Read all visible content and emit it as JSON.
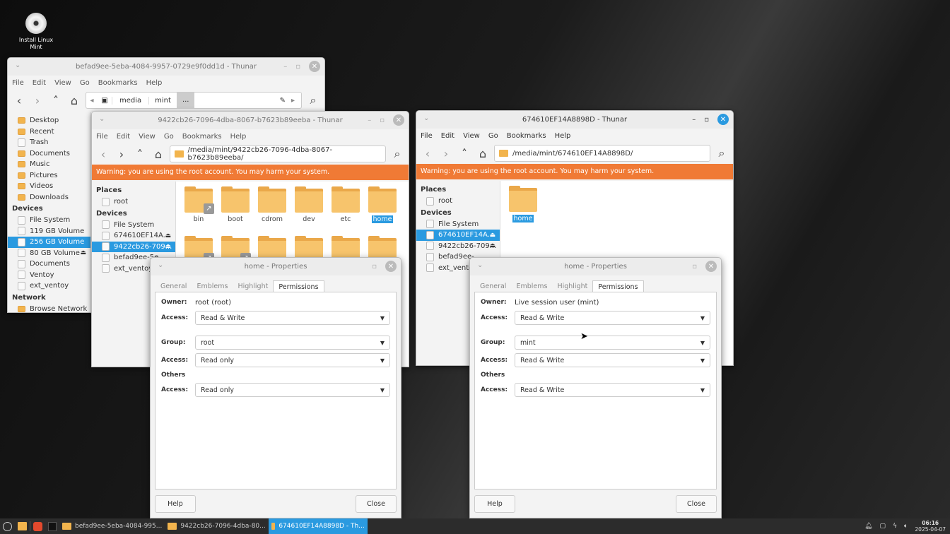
{
  "desktop": {
    "icon_label": "Install Linux Mint"
  },
  "menu": [
    "File",
    "Edit",
    "View",
    "Go",
    "Bookmarks",
    "Help"
  ],
  "win_a": {
    "title": "befad9ee-5eba-4084-9957-0729e9f0dd1d - Thunar",
    "crumbs": [
      "media",
      "mint",
      "..."
    ],
    "sidebar": [
      {
        "label": "Desktop",
        "icon": "f"
      },
      {
        "label": "Recent",
        "icon": "f"
      },
      {
        "label": "Trash",
        "icon": "d"
      },
      {
        "label": "Documents",
        "icon": "f"
      },
      {
        "label": "Music",
        "icon": "f"
      },
      {
        "label": "Pictures",
        "icon": "f"
      },
      {
        "label": "Videos",
        "icon": "f"
      },
      {
        "label": "Downloads",
        "icon": "f"
      },
      {
        "label": "Devices",
        "header": true
      },
      {
        "label": "File System"
      },
      {
        "label": "119 GB Volume"
      },
      {
        "label": "256 GB Volume",
        "sel": true
      },
      {
        "label": "80 GB Volume",
        "eject": true
      },
      {
        "label": "Documents"
      },
      {
        "label": "Ventoy"
      },
      {
        "label": "ext_ventoy"
      },
      {
        "label": "Network",
        "header": true
      },
      {
        "label": "Browse Network",
        "icon": "f"
      }
    ]
  },
  "win_b": {
    "title": "9422cb26-7096-4dba-8067-b7623b89eeba - Thunar",
    "path": "/media/mint/9422cb26-7096-4dba-8067-b7623b89eeba/",
    "warning": "Warning: you are using the root account. You may harm your system.",
    "sidebar": [
      {
        "label": "Places",
        "header": true
      },
      {
        "label": "root"
      },
      {
        "label": "Devices",
        "header": true
      },
      {
        "label": "File System"
      },
      {
        "label": "674610EF14A...",
        "eject": true
      },
      {
        "label": "9422cb26-709...",
        "eject": true,
        "sel": true
      },
      {
        "label": "befad9ee-5e"
      },
      {
        "label": "ext_ventoy"
      }
    ],
    "files": [
      {
        "name": "bin",
        "link": true
      },
      {
        "name": "boot"
      },
      {
        "name": "cdrom"
      },
      {
        "name": "dev"
      },
      {
        "name": "etc"
      },
      {
        "name": "home",
        "sel": true
      },
      {
        "name": "",
        "link": true
      },
      {
        "name": "",
        "link": true
      },
      {
        "name": ""
      },
      {
        "name": ""
      },
      {
        "name": ""
      },
      {
        "name": ""
      }
    ]
  },
  "win_c": {
    "title": "674610EF14A8898D - Thunar",
    "path": "/media/mint/674610EF14A8898D/",
    "warning": "Warning: you are using the root account. You may harm your system.",
    "sidebar": [
      {
        "label": "Places",
        "header": true
      },
      {
        "label": "root"
      },
      {
        "label": "Devices",
        "header": true
      },
      {
        "label": "File System"
      },
      {
        "label": "674610EF14A...",
        "eject": true,
        "sel": true
      },
      {
        "label": "9422cb26-709...",
        "eject": true
      },
      {
        "label": "befad9ee-"
      },
      {
        "label": "ext_ventoy"
      }
    ],
    "files": [
      {
        "name": "home",
        "sel": true
      }
    ]
  },
  "dlg_tabs": [
    "General",
    "Emblems",
    "Highlight",
    "Permissions"
  ],
  "labels": {
    "owner": "Owner:",
    "access": "Access:",
    "group": "Group:",
    "others": "Others",
    "help": "Help",
    "close": "Close"
  },
  "dlg_1": {
    "title": "home - Properties",
    "owner": "root (root)",
    "owner_access": "Read & Write",
    "group": "root",
    "group_access": "Read only",
    "others_access": "Read only"
  },
  "dlg_2": {
    "title": "home - Properties",
    "owner": "Live session user (mint)",
    "owner_access": "Read & Write",
    "group": "mint",
    "group_access": "Read & Write",
    "others_access": "Read & Write"
  },
  "taskbar": {
    "tasks": [
      "befad9ee-5eba-4084-995...",
      "9422cb26-7096-4dba-80...",
      "674610EF14A8898D - Th..."
    ],
    "time": "06:16",
    "date": "2025-04-07"
  }
}
